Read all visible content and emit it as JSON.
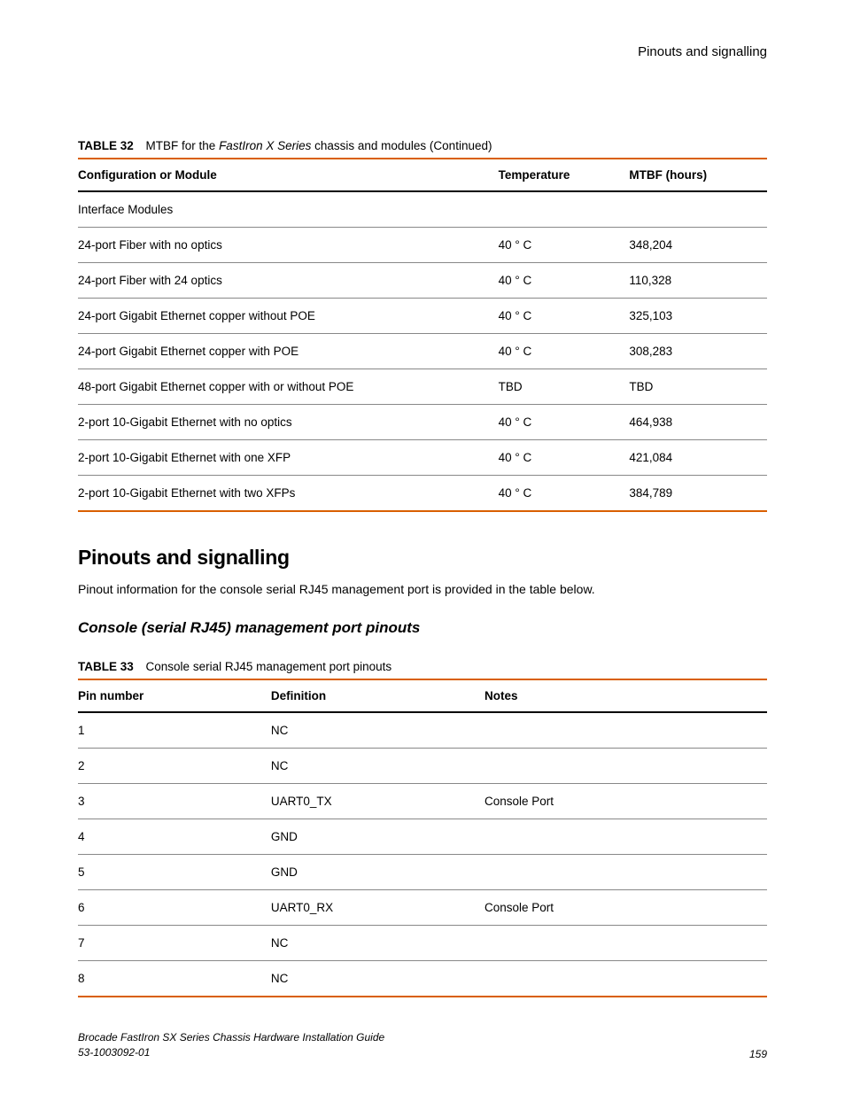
{
  "header": {
    "running_title": "Pinouts and signalling"
  },
  "table32": {
    "label": "TABLE 32",
    "caption_prefix": "MTBF for the ",
    "caption_italic": "FastIron X Series",
    "caption_suffix": " chassis and modules (Continued)",
    "columns": {
      "config": "Configuration or Module",
      "temp": "Temperature",
      "mtbf": "MTBF (hours)"
    },
    "section_label": "Interface Modules",
    "rows": [
      {
        "config": "24-port Fiber with no optics",
        "temp": "40 ° C",
        "mtbf": "348,204"
      },
      {
        "config": "24-port Fiber with 24 optics",
        "temp": "40 ° C",
        "mtbf": "110,328"
      },
      {
        "config": "24-port Gigabit Ethernet copper without POE",
        "temp": "40 ° C",
        "mtbf": "325,103"
      },
      {
        "config": "24-port Gigabit Ethernet copper with POE",
        "temp": "40 ° C",
        "mtbf": "308,283"
      },
      {
        "config": "48-port Gigabit Ethernet copper with or without POE",
        "temp": "TBD",
        "mtbf": "TBD"
      },
      {
        "config": "2-port 10-Gigabit Ethernet with no optics",
        "temp": "40 ° C",
        "mtbf": "464,938"
      },
      {
        "config": "2-port 10-Gigabit Ethernet with one XFP",
        "temp": "40 ° C",
        "mtbf": "421,084"
      },
      {
        "config": "2-port 10-Gigabit Ethernet with two XFPs",
        "temp": "40 ° C",
        "mtbf": "384,789"
      }
    ]
  },
  "section": {
    "heading": "Pinouts and signalling",
    "paragraph": "Pinout information for the console serial RJ45 management port is provided in the table below.",
    "subheading": "Console (serial RJ45) management port pinouts"
  },
  "table33": {
    "label": "TABLE 33",
    "caption": "Console serial RJ45 management port pinouts",
    "columns": {
      "pin": "Pin number",
      "def": "Definition",
      "notes": "Notes"
    },
    "rows": [
      {
        "pin": "1",
        "def": "NC",
        "notes": ""
      },
      {
        "pin": "2",
        "def": "NC",
        "notes": ""
      },
      {
        "pin": "3",
        "def": "UART0_TX",
        "notes": "Console Port"
      },
      {
        "pin": "4",
        "def": "GND",
        "notes": ""
      },
      {
        "pin": "5",
        "def": "GND",
        "notes": ""
      },
      {
        "pin": "6",
        "def": "UART0_RX",
        "notes": "Console Port"
      },
      {
        "pin": "7",
        "def": "NC",
        "notes": ""
      },
      {
        "pin": "8",
        "def": "NC",
        "notes": ""
      }
    ]
  },
  "footer": {
    "guide": "Brocade FastIron SX Series Chassis Hardware Installation Guide",
    "docnum": "53-1003092-01",
    "page": "159"
  }
}
